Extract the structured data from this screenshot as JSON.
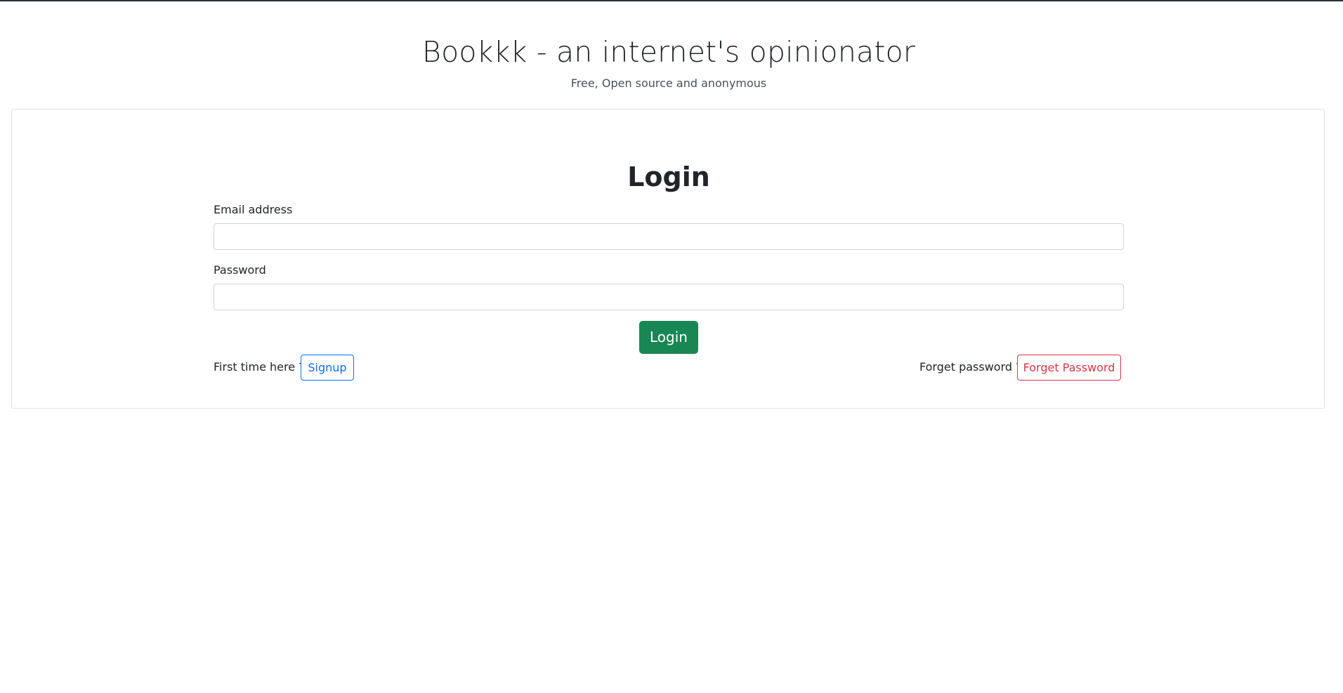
{
  "header": {
    "title": "Bookkk - an internet's opinionator",
    "subtitle": "Free, Open source and anonymous"
  },
  "login_form": {
    "heading": "Login",
    "email_label": "Email address",
    "email_value": "",
    "password_label": "Password",
    "password_value": "",
    "submit_label": "Login"
  },
  "footer_links": {
    "signup_prompt": "First time here ?",
    "signup_label": "Signup",
    "forgot_prompt": "Forget password ?",
    "forgot_label": "Forget Password"
  },
  "colors": {
    "success": "#198754",
    "primary": "#0d6efd",
    "danger": "#dc3545",
    "top_border": "#2b2f3a"
  }
}
